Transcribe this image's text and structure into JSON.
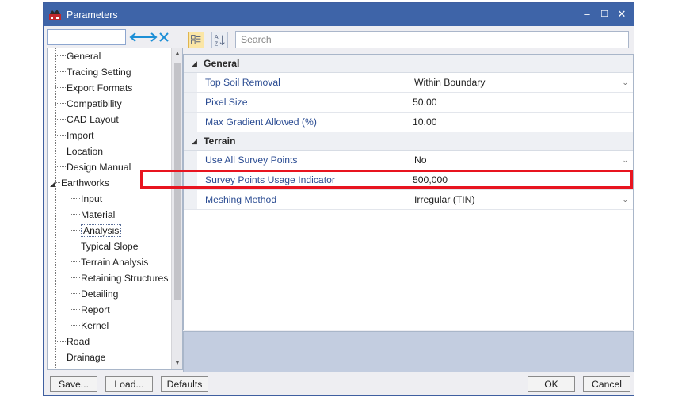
{
  "window": {
    "title": "Parameters",
    "minimize": "–",
    "maximize": "☐",
    "close": "✕"
  },
  "filter": {
    "placeholder": "",
    "clear_glyph": "✕"
  },
  "tree": {
    "items": [
      {
        "label": "General",
        "level": 0
      },
      {
        "label": "Tracing Setting",
        "level": 0
      },
      {
        "label": "Export Formats",
        "level": 0
      },
      {
        "label": "Compatibility",
        "level": 0
      },
      {
        "label": "CAD Layout",
        "level": 0
      },
      {
        "label": "Import",
        "level": 0
      },
      {
        "label": "Location",
        "level": 0
      },
      {
        "label": "Design Manual",
        "level": 0
      },
      {
        "label": "Earthworks",
        "level": 0,
        "expanded": true
      },
      {
        "label": "Input",
        "level": 1
      },
      {
        "label": "Material",
        "level": 1
      },
      {
        "label": "Analysis",
        "level": 1,
        "selected": true
      },
      {
        "label": "Typical Slope",
        "level": 1
      },
      {
        "label": "Terrain Analysis",
        "level": 1
      },
      {
        "label": "Retaining Structures",
        "level": 1
      },
      {
        "label": "Detailing",
        "level": 1
      },
      {
        "label": "Report",
        "level": 1
      },
      {
        "label": "Kernel",
        "level": 1
      },
      {
        "label": "Road",
        "level": 0
      },
      {
        "label": "Drainage",
        "level": 0
      }
    ]
  },
  "search": {
    "placeholder": "Search"
  },
  "grid": {
    "categories": [
      {
        "label": "General",
        "rows": [
          {
            "name": "Top Soil Removal",
            "value": "Within Boundary",
            "dropdown": true
          },
          {
            "name": "Pixel Size",
            "value": "50.00",
            "dropdown": false
          },
          {
            "name": "Max Gradient Allowed (%)",
            "value": "10.00",
            "dropdown": false
          }
        ]
      },
      {
        "label": "Terrain",
        "rows": [
          {
            "name": "Use All Survey Points",
            "value": "No",
            "dropdown": true
          },
          {
            "name": "Survey Points Usage Indicator",
            "value": "500,000",
            "dropdown": false
          },
          {
            "name": "Meshing Method",
            "value": "Irregular (TIN)",
            "dropdown": true
          }
        ]
      }
    ]
  },
  "buttons": {
    "save": "Save...",
    "load": "Load...",
    "defaults": "Defaults",
    "ok": "OK",
    "cancel": "Cancel"
  },
  "colors": {
    "titlebar": "#3e64a8",
    "highlight": "#e8141f",
    "property_name": "#2c4d93",
    "filter_accent": "#1d8fd6"
  }
}
